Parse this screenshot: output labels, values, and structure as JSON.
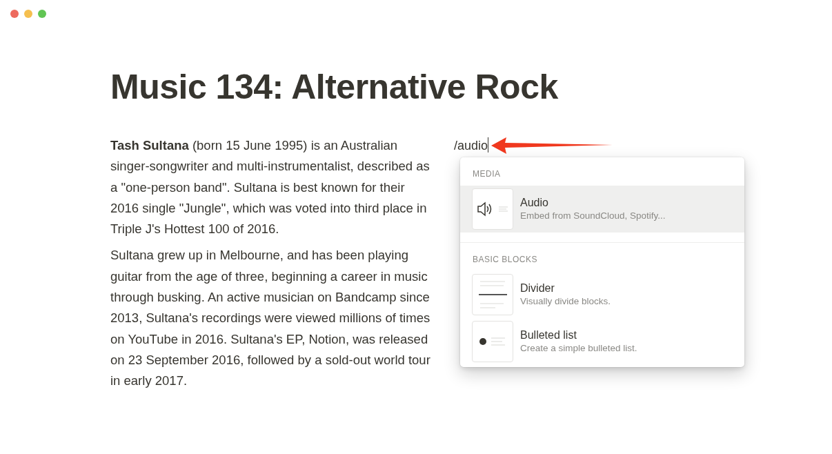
{
  "window": {
    "controls": [
      {
        "color": "#ed6a5e"
      },
      {
        "color": "#f5bf4f"
      },
      {
        "color": "#61c554"
      }
    ]
  },
  "page": {
    "title": "Music 134: Alternative Rock",
    "paragraphs": [
      "**Tash Sultana** (born 15 June 1995) is an Australian singer-songwriter and multi-instrumentalist, described as a \"one-person band\". Sultana is best known for their 2016 single \"Jungle\", which was voted into third place in Triple J's Hottest 100 of 2016.",
      "Sultana grew up in Melbourne, and has been playing guitar from the age of three, beginning a career in music through busking. An active musician on Bandcamp since 2013, Sultana's recordings were viewed millions of times on YouTube in 2016. Sultana's EP, Notion, was released on 23 September 2016, followed by a sold-out world tour in early 2017."
    ]
  },
  "command": {
    "value": "/audio"
  },
  "menu": {
    "sections": [
      {
        "heading": "MEDIA",
        "items": [
          {
            "kind": "audio",
            "title": "Audio",
            "description": "Embed from SoundCloud, Spotify...",
            "selected": true
          }
        ]
      },
      {
        "heading": "BASIC BLOCKS",
        "items": [
          {
            "kind": "divider",
            "title": "Divider",
            "description": "Visually divide blocks.",
            "selected": false
          },
          {
            "kind": "bulleted",
            "title": "Bulleted list",
            "description": "Create a simple bulleted list.",
            "selected": false
          }
        ]
      }
    ]
  }
}
